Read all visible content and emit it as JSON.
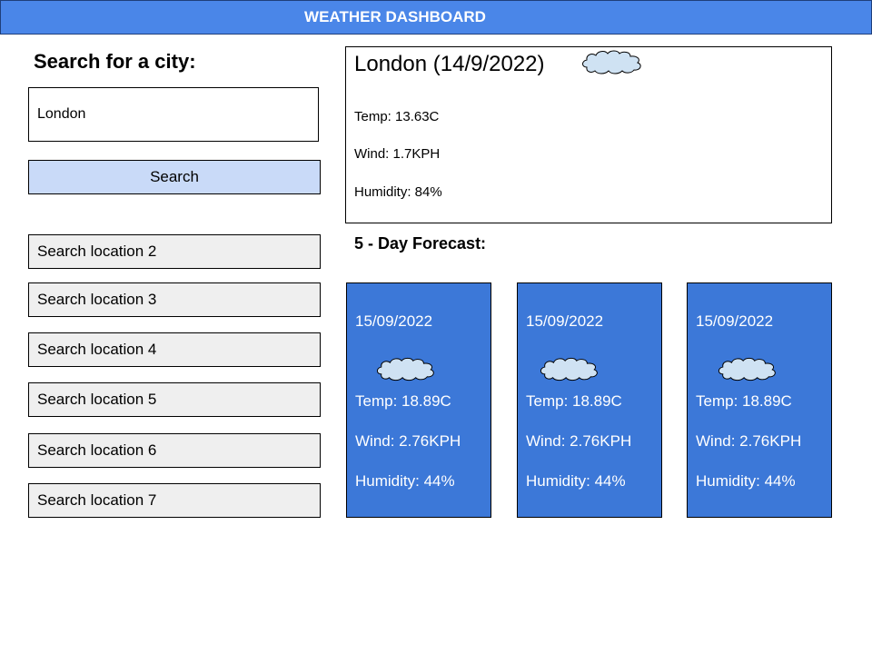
{
  "header": {
    "title": "WEATHER DASHBOARD"
  },
  "search": {
    "heading": "Search for a city:",
    "input_value": "London",
    "button_label": "Search"
  },
  "history": [
    "Search location 2",
    "Search location 3",
    "Search location 4",
    "Search location 5",
    "Search location 6",
    "Search location 7"
  ],
  "current": {
    "title": "London (14/9/2022)",
    "icon": "cloud-icon",
    "temp": "Temp: 13.63C",
    "wind": "Wind: 1.7KPH",
    "humidity": "Humidity: 84%"
  },
  "forecast": {
    "heading": "5 - Day Forecast:",
    "days": [
      {
        "date": "15/09/2022",
        "icon": "cloud-icon",
        "temp": "Temp: 18.89C",
        "wind": "Wind: 2.76KPH",
        "humidity": "Humidity: 44%"
      },
      {
        "date": "15/09/2022",
        "icon": "cloud-icon",
        "temp": "Temp: 18.89C",
        "wind": "Wind: 2.76KPH",
        "humidity": "Humidity: 44%"
      },
      {
        "date": "15/09/2022",
        "icon": "cloud-icon",
        "temp": "Temp: 18.89C",
        "wind": "Wind: 2.76KPH",
        "humidity": "Humidity: 44%"
      }
    ]
  },
  "colors": {
    "header_bg": "#4a86e8",
    "search_button_bg": "#c9daf8",
    "history_bg": "#efefef",
    "forecast_card_bg": "#3c78d8",
    "cloud_fill": "#cfe2f3"
  }
}
